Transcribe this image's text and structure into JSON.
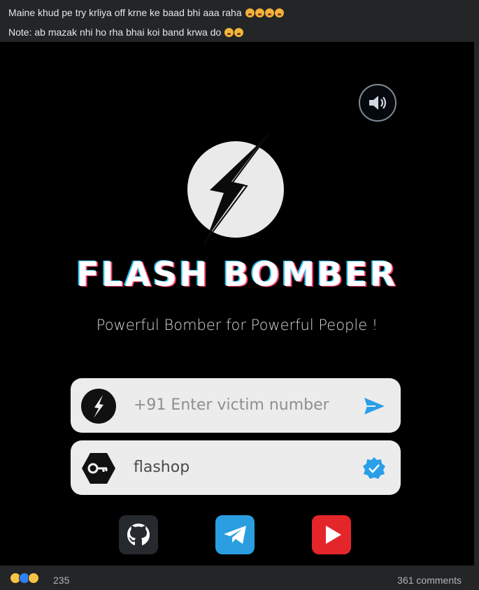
{
  "post": {
    "caption_line1": "Maine khud pe try krliya off krne ke baad bhi aaa raha",
    "caption_line2": "Note: ab mazak nhi ho rha bhai koi band krwa do"
  },
  "app": {
    "brand": "FLASH BOMBER",
    "tagline": "Powerful Bomber for Powerful People !",
    "phone_placeholder": "+91 Enter victim number",
    "key_value": "flashop",
    "colors": {
      "brand_glow_cyan": "#2fc3f3",
      "brand_glow_pink": "#ff3a6b",
      "send_blue": "#2a9ee8",
      "verified_blue": "#2a9ee8",
      "telegram": "#2b9ee1",
      "youtube": "#e4262a",
      "github": "#262a2e"
    },
    "icons": {
      "speaker": "speaker-icon",
      "logo": "lightning-bolt-icon",
      "send": "send-icon",
      "key": "key-icon",
      "verified": "verified-badge-icon",
      "github": "github-icon",
      "telegram": "telegram-icon",
      "youtube": "youtube-icon"
    }
  },
  "footer": {
    "reaction_count": "235",
    "comments": "361 comments"
  }
}
